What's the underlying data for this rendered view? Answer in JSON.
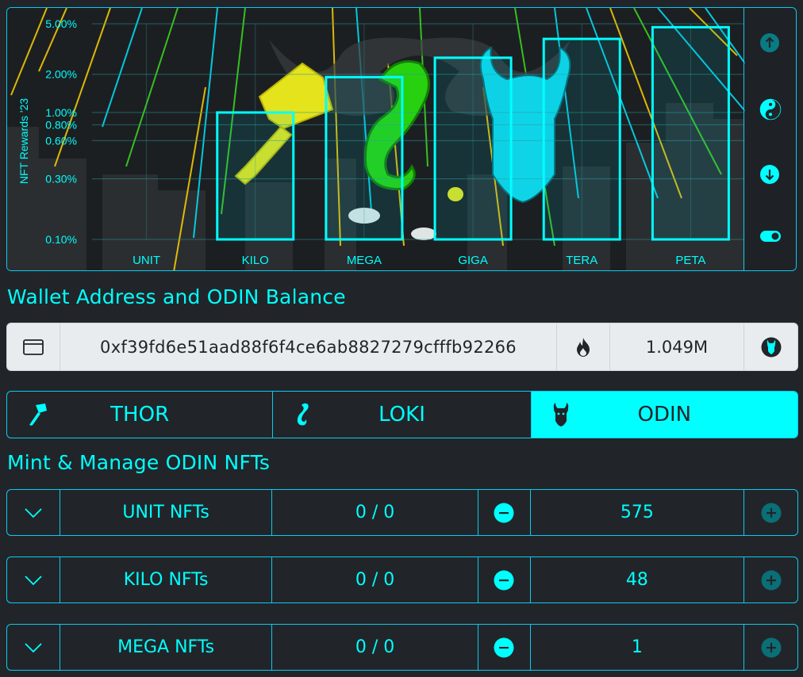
{
  "chart_data": {
    "type": "bar",
    "ylabel": "NFT Rewards '23",
    "yscale": "log",
    "ylim": [
      0.1,
      5.0
    ],
    "yticks": [
      "5.00%",
      "2.00%",
      "1.00%",
      "0.80%",
      "0.60%",
      "0.30%",
      "0.10%"
    ],
    "ytick_values": [
      5.0,
      2.0,
      1.0,
      0.8,
      0.6,
      0.3,
      0.1
    ],
    "categories": [
      "UNIT",
      "KILO",
      "MEGA",
      "GIGA",
      "TERA",
      "PETA"
    ],
    "values": [
      0.1,
      1.0,
      1.9,
      2.7,
      3.8,
      4.7
    ],
    "colors": {
      "bar_stroke": "#00ffff",
      "grid": "#2a9a9a",
      "text": "#00ffff"
    }
  },
  "side_buttons": [
    {
      "icon": "arrow-up-icon",
      "active": false
    },
    {
      "icon": "yin-yang-icon",
      "active": true
    },
    {
      "icon": "arrow-down-icon",
      "active": true
    },
    {
      "icon": "toggle-on-icon",
      "active": true
    }
  ],
  "wallet_section": {
    "title": "Wallet Address and ODIN Balance",
    "address": "0xf39fd6e51aad88f6f4ce6ab8827279cfffb92266",
    "balance": "1.049M",
    "icons": [
      "wallet-icon",
      "fire-icon",
      "odin-token-icon"
    ]
  },
  "tabs": [
    {
      "label": "THOR",
      "icon": "hammer-icon",
      "active": false
    },
    {
      "label": "LOKI",
      "icon": "loki-icon",
      "active": false
    },
    {
      "label": "ODIN",
      "icon": "odin-icon",
      "active": true
    }
  ],
  "manage_section": {
    "title": "Mint & Manage ODIN NFTs"
  },
  "nft_rows": [
    {
      "name": "UNIT NFTs",
      "owned": "0 / 0",
      "amount": "575"
    },
    {
      "name": "KILO NFTs",
      "owned": "0 / 0",
      "amount": "48"
    },
    {
      "name": "MEGA NFTs",
      "owned": "0 / 0",
      "amount": "1"
    }
  ],
  "colors": {
    "accent": "#00ffff",
    "background": "#212529",
    "input_bg": "#e9ecef"
  }
}
